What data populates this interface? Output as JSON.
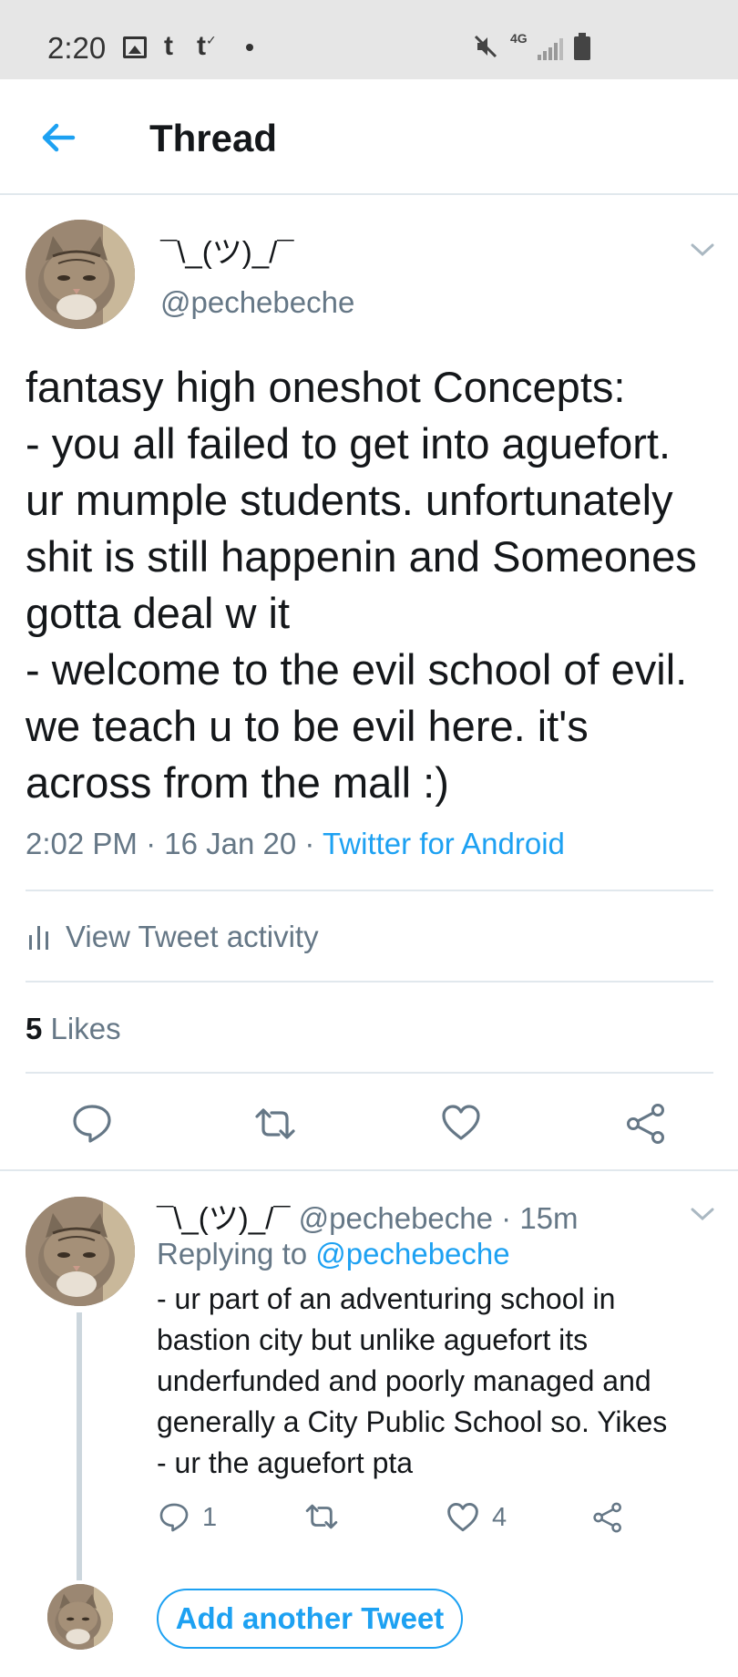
{
  "status_bar": {
    "time": "2:20",
    "network": "4G"
  },
  "header": {
    "title": "Thread"
  },
  "main_tweet": {
    "display_name": "¯\\_(ツ)_/¯",
    "handle": "@pechebeche",
    "text": "fantasy high oneshot Concepts:\n- you all failed to get into aguefort. ur mumple students. unfortunately shit is still happenin and Someones gotta deal w it\n- welcome to the evil school of evil. we teach u to be evil here. it's across from the mall :)",
    "time": "2:02 PM",
    "date": "16 Jan 20",
    "separator": " · ",
    "source": "Twitter for Android",
    "activity_label": "View Tweet activity",
    "likes_count": "5",
    "likes_label": "Likes"
  },
  "reply_tweet": {
    "display_name": "¯\\_(ツ)_/¯",
    "handle": "@pechebeche",
    "dot": "·",
    "time": "15m",
    "replying_prefix": "Replying to",
    "replying_handle": "@pechebeche",
    "text": "- ur part of an adventuring school in bastion city but unlike aguefort its underfunded and poorly managed and generally a City Public School so. Yikes\n- ur the aguefort pta",
    "reply_count": "1",
    "like_count": "4"
  },
  "composer": {
    "button_label": "Add another Tweet"
  },
  "colors": {
    "accent": "#1da1f2",
    "secondary_text": "#657786",
    "divider": "#e1e8ed"
  }
}
